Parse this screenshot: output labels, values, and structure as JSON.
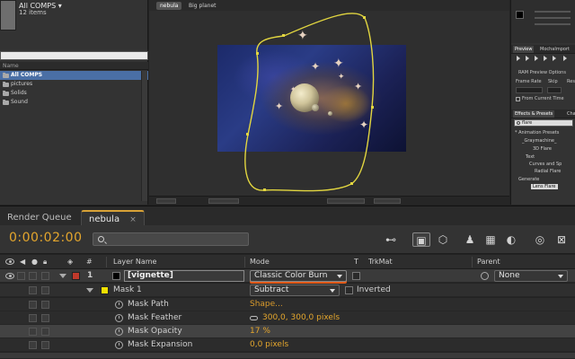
{
  "project": {
    "title": "All COMPS ▾",
    "count": "12 items",
    "col_name": "Name",
    "items": [
      {
        "label": "All COMPS",
        "selected": true
      },
      {
        "label": "pictures",
        "selected": false
      },
      {
        "label": "Solids",
        "selected": false
      },
      {
        "label": "Sound",
        "selected": false
      }
    ]
  },
  "viewer": {
    "tabs": [
      "nebula",
      "Big planet"
    ]
  },
  "right_panel": {
    "preview_tabs": [
      "Preview",
      "MochaImport"
    ],
    "ram_options": "RAM Preview Options",
    "frame_rate": "Frame Rate",
    "skip": "Skip",
    "res": "Res",
    "from_current": "From Current Time",
    "effects_tabs": [
      "Effects & Presets",
      "Cha"
    ],
    "search_value": "flare",
    "fx_items": [
      "* Animation Presets",
      "_Graymachine_",
      "3D Flare",
      "Text",
      "Curves and Sp",
      "Radial Flare",
      "Generate",
      "Lens Flare"
    ]
  },
  "timeline": {
    "tabs": {
      "render_queue": "Render Queue",
      "nebula": "nebula",
      "close": "×"
    },
    "timecode": "0:00:02:00",
    "headers": {
      "number": "#",
      "layer_name": "Layer Name",
      "mode": "Mode",
      "t": "T",
      "trkmat": "TrkMat",
      "parent": "Parent"
    },
    "layers": [
      {
        "number": "1",
        "name": "[vignette]",
        "mode": "Classic Color Burn",
        "parent": "None",
        "label_color": "#c0392b",
        "mask": {
          "name": "Mask 1",
          "mode": "Subtract",
          "inverted_label": "Inverted",
          "label_color": "#f0e000",
          "properties": [
            {
              "name": "Mask Path",
              "value": "Shape..."
            },
            {
              "name": "Mask Feather",
              "value": "300,0, 300,0 pixels"
            },
            {
              "name": "Mask Opacity",
              "value": "17 %"
            },
            {
              "name": "Mask Expansion",
              "value": "0,0 pixels"
            }
          ]
        }
      }
    ]
  },
  "colors": {
    "timecode": "#e4a62d",
    "mask_path": "#e2d640",
    "accent_tab": "#d8a236"
  }
}
